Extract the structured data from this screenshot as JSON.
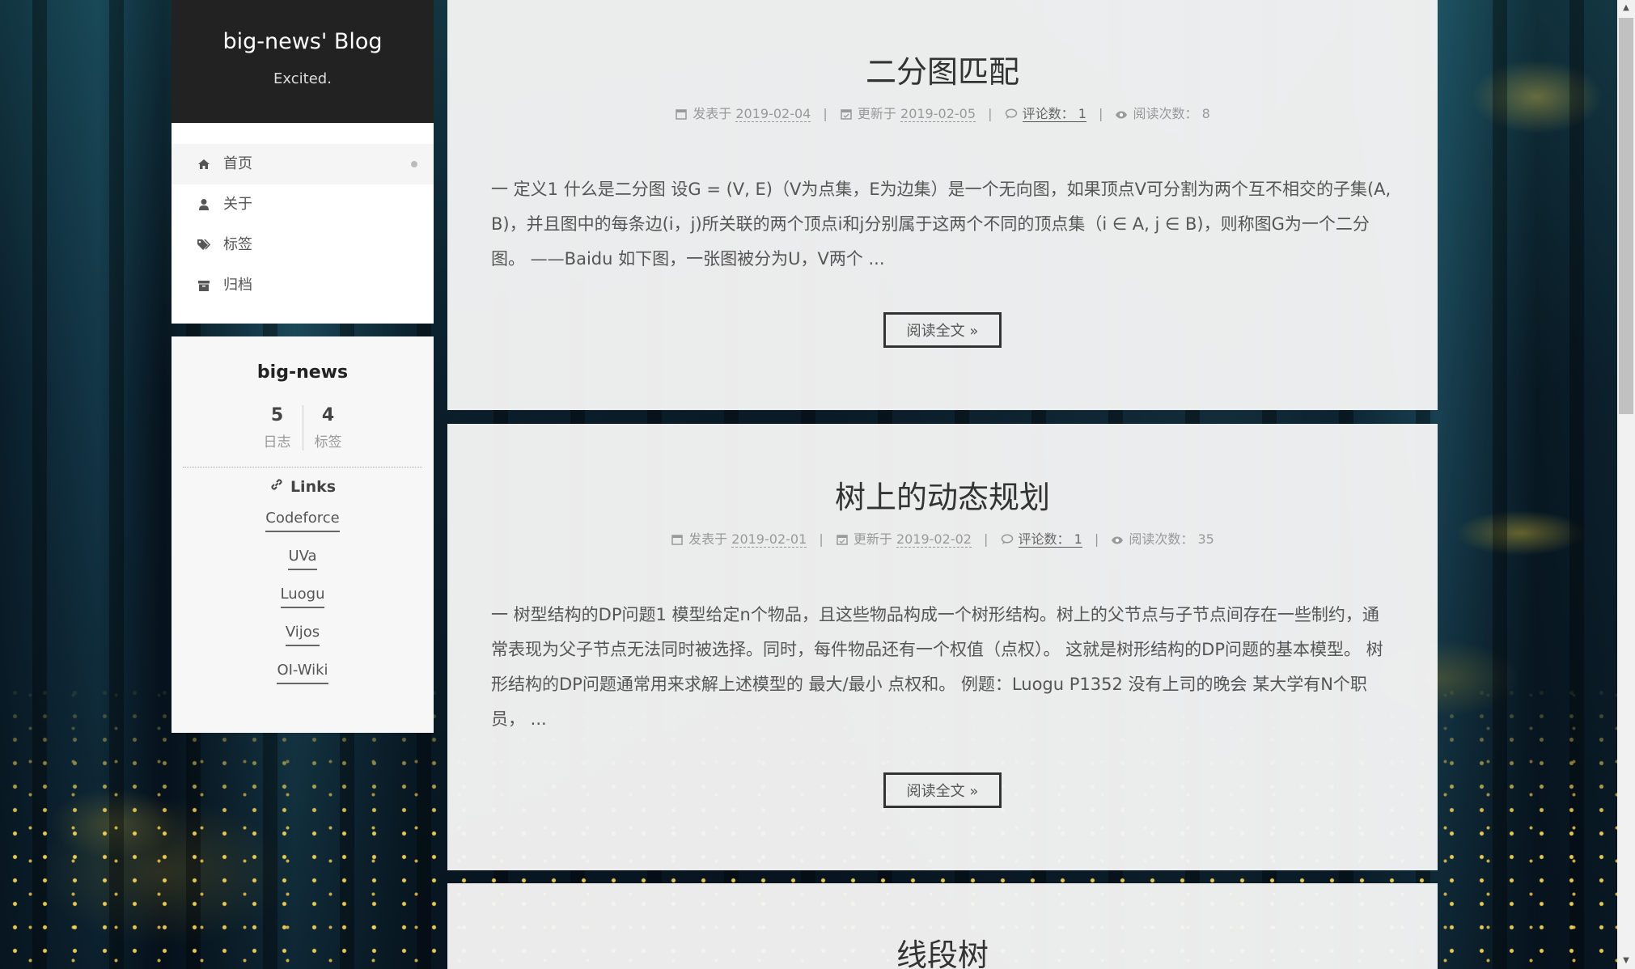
{
  "site": {
    "title": "big-news' Blog",
    "subtitle": "Excited."
  },
  "menu": {
    "items": [
      {
        "label": "首页",
        "icon": "home-icon",
        "active": true
      },
      {
        "label": "关于",
        "icon": "user-icon",
        "active": false
      },
      {
        "label": "标签",
        "icon": "tags-icon",
        "active": false
      },
      {
        "label": "归档",
        "icon": "archive-icon",
        "active": false
      }
    ]
  },
  "author": {
    "name": "big-news",
    "posts_count": "5",
    "posts_label": "日志",
    "tags_count": "4",
    "tags_label": "标签"
  },
  "links": {
    "title": "Links",
    "items": [
      "Codeforce",
      "UVa",
      "Luogu",
      "Vijos",
      "OI-Wiki"
    ]
  },
  "posts": [
    {
      "title": "二分图匹配",
      "posted_label": "发表于",
      "posted_date": "2019-02-04",
      "updated_label": "更新于",
      "updated_date": "2019-02-05",
      "comments_label": "评论数：",
      "comments_count": "1",
      "views_label": "阅读次数：",
      "views_count": "8",
      "excerpt": "一 定义1 什么是二分图 设G = (V, E)（V为点集，E为边集）是一个无向图，如果顶点V可分割为两个互不相交的子集(A, B)，并且图中的每条边(i，j)所关联的两个顶点i和j分别属于这两个不同的顶点集（i ∈ A, j ∈ B)，则称图G为一个二分图。 ——Baidu 如下图，一张图被分为U，V两个 ...",
      "read_more": "阅读全文 »"
    },
    {
      "title": "树上的动态规划",
      "posted_label": "发表于",
      "posted_date": "2019-02-01",
      "updated_label": "更新于",
      "updated_date": "2019-02-02",
      "comments_label": "评论数：",
      "comments_count": "1",
      "views_label": "阅读次数：",
      "views_count": "35",
      "excerpt": "一 树型结构的DP问题1 模型给定n个物品，且这些物品构成一个树形结构。树上的父节点与子节点间存在一些制约，通常表现为父子节点无法同时被选择。同时，每件物品还有一个权值（点权）。 这就是树形结构的DP问题的基本模型。 树形结构的DP问题通常用来求解上述模型的 最大/最小 点权和。 例题：Luogu P1352 没有上司的晚会 某大学有N个职员， ...",
      "read_more": "阅读全文 »"
    },
    {
      "title": "线段树"
    }
  ],
  "colors": {
    "sidebar_header_bg": "#222222",
    "post_bg": "#f5f5f5",
    "text": "#555555"
  }
}
